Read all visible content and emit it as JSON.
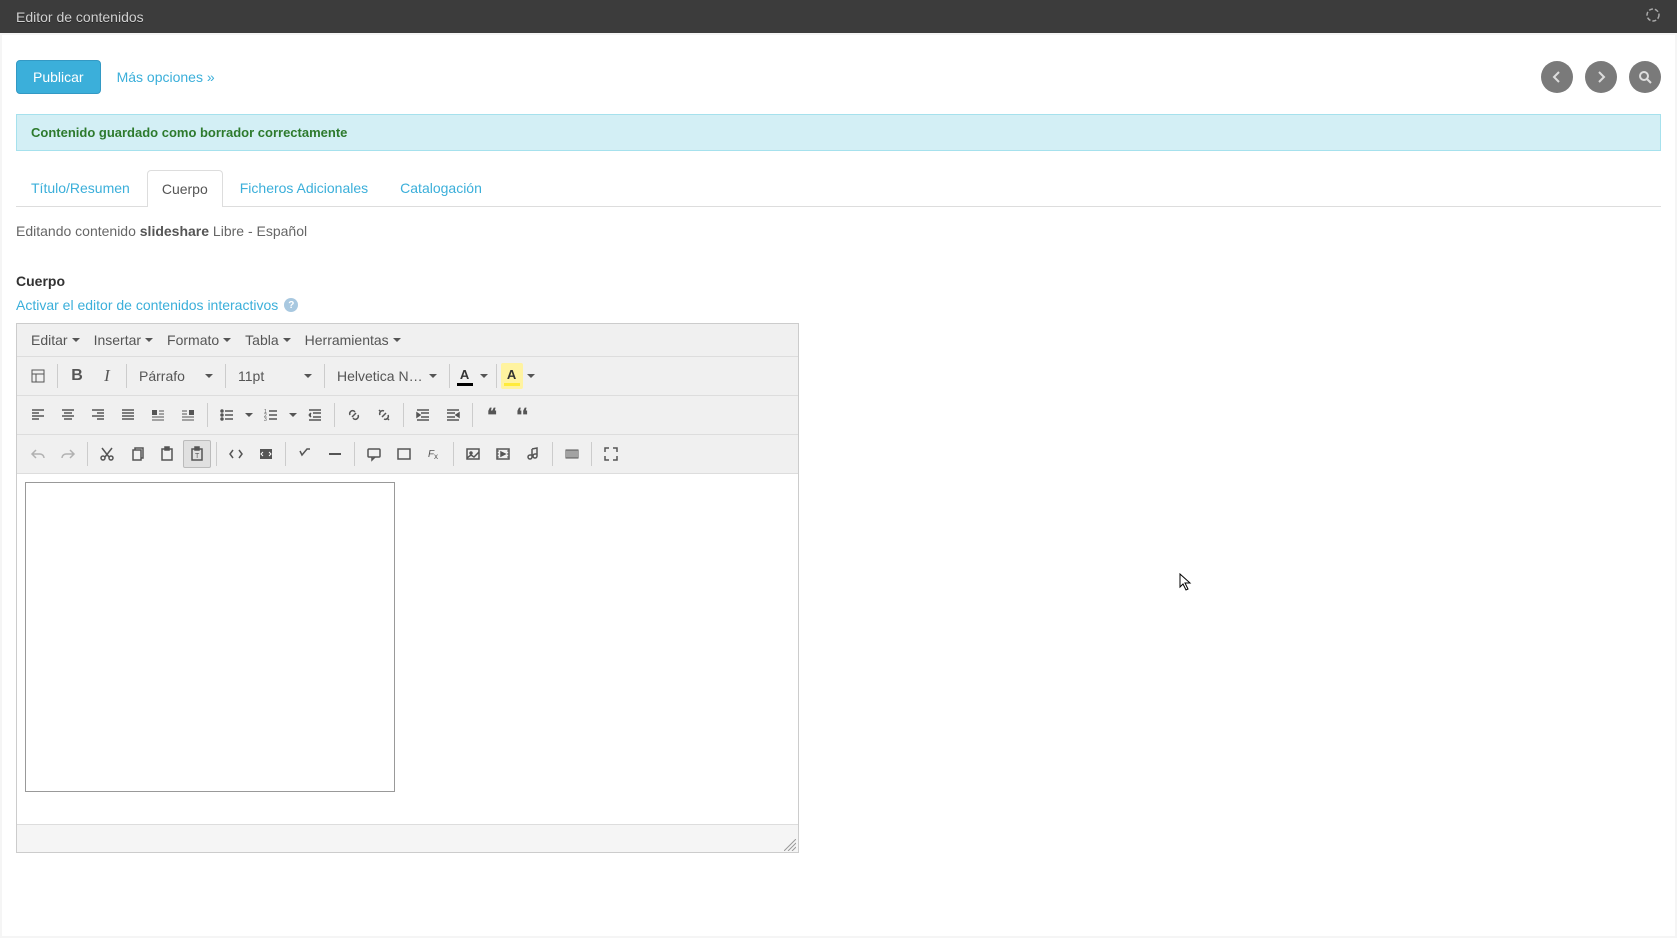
{
  "title_bar": "Editor de contenidos",
  "actions": {
    "publish": "Publicar",
    "more_options": "Más opciones »"
  },
  "alert": "Contenido guardado como borrador correctamente",
  "tabs": [
    "Título/Resumen",
    "Cuerpo",
    "Ficheros Adicionales",
    "Catalogación"
  ],
  "editing": {
    "prefix": "Editando contenido ",
    "name": "slideshare",
    "suffix": "  Libre - Español"
  },
  "section_heading": "Cuerpo",
  "interactive_link": "Activar el editor de contenidos interactivos",
  "help_q": "?",
  "editor": {
    "menu": {
      "edit": "Editar",
      "insert": "Insertar",
      "format": "Formato",
      "table": "Tabla",
      "tools": "Herramientas"
    },
    "format_label": "Párrafo",
    "font_size": "11pt",
    "font_family": "Helvetica N…",
    "text_color_a": "A",
    "bg_color_a": "A"
  }
}
